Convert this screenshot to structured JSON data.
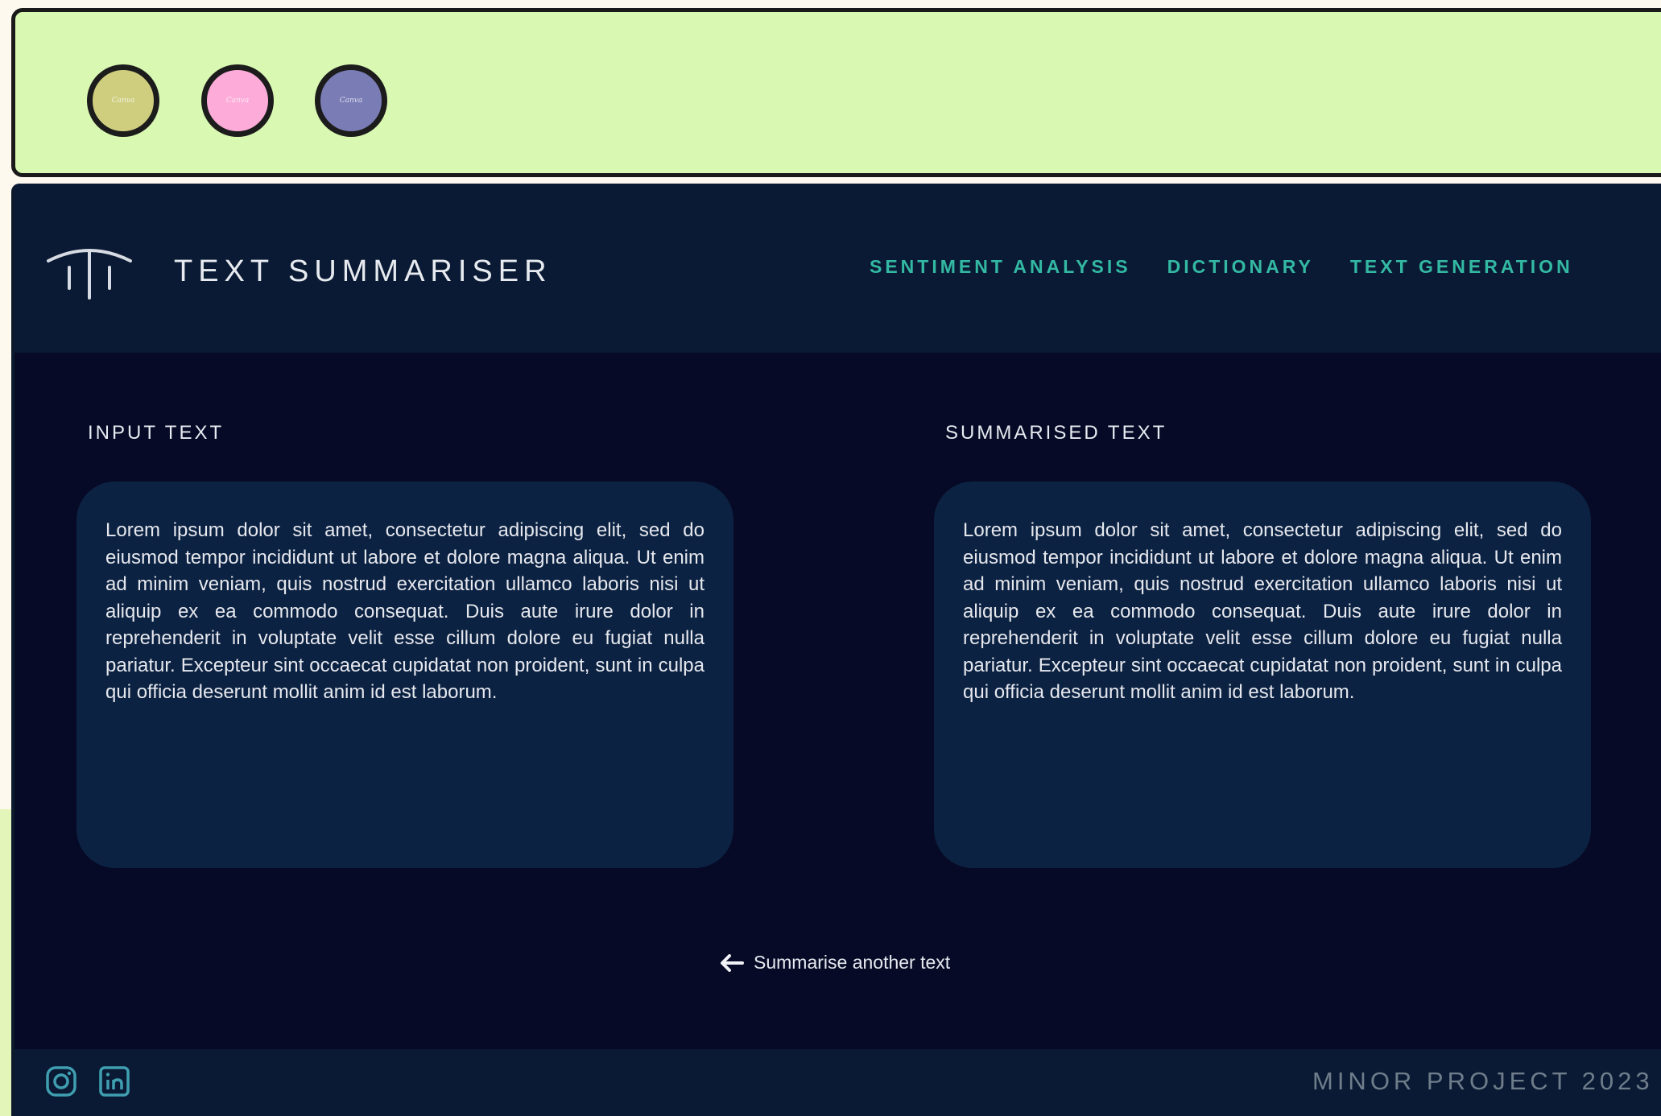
{
  "window": {
    "dots": [
      {
        "label": "Canva",
        "color": "#cfce7f"
      },
      {
        "label": "Canva",
        "color": "#fdabd9"
      },
      {
        "label": "Canva",
        "color": "#7a7cb6"
      }
    ]
  },
  "header": {
    "logo_icon": "pillars-logo-icon",
    "title": "TEXT SUMMARISER",
    "nav": [
      {
        "label": "SENTIMENT ANALYSIS"
      },
      {
        "label": "DICTIONARY"
      },
      {
        "label": "TEXT GENERATION"
      }
    ]
  },
  "main": {
    "input": {
      "label": "INPUT TEXT",
      "text": "Lorem ipsum dolor sit amet, consectetur adipiscing elit, sed do eiusmod tempor incididunt ut labore et dolore magna aliqua. Ut enim ad minim veniam, quis nostrud exercitation ullamco laboris nisi ut aliquip ex ea commodo consequat. Duis aute irure dolor in reprehenderit in voluptate velit esse cillum dolore eu fugiat nulla pariatur. Excepteur sint occaecat cupidatat non proident, sunt in culpa qui officia deserunt mollit anim id est laborum."
    },
    "output": {
      "label": "SUMMARISED TEXT",
      "text": "Lorem ipsum dolor sit amet, consectetur adipiscing elit, sed do eiusmod tempor incididunt ut labore et dolore magna aliqua. Ut enim ad minim veniam, quis nostrud exercitation ullamco laboris nisi ut aliquip ex ea commodo consequat. Duis aute irure dolor in reprehenderit in voluptate velit esse cillum dolore eu fugiat nulla pariatur. Excepteur sint occaecat cupidatat non proident, sunt in culpa qui officia deserunt mollit anim id est laborum."
    },
    "back_link": {
      "icon": "arrow-left-icon",
      "label": "Summarise another text"
    }
  },
  "footer": {
    "social": [
      {
        "icon": "instagram-icon"
      },
      {
        "icon": "linkedin-icon"
      }
    ],
    "text": "MINOR PROJECT 2023"
  },
  "colors": {
    "bar": "#d9f8b1",
    "app_bg": "#060a26",
    "header_bg": "#0a1a34",
    "panel_bg": "#0c2242",
    "accent": "#33b9a3",
    "muted": "#6f7d8b"
  }
}
